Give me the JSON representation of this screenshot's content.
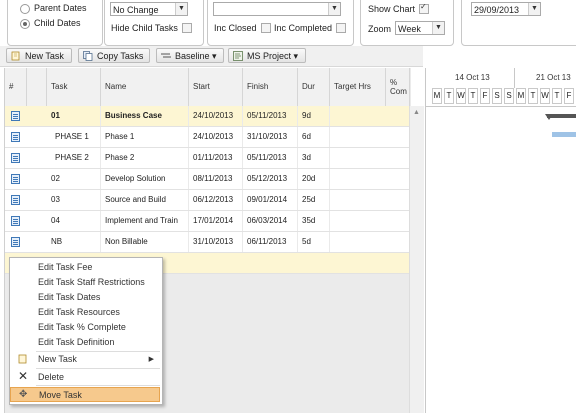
{
  "filters": {
    "date_options": [
      {
        "label": "Parent Dates",
        "checked": false
      },
      {
        "label": "Child Dates",
        "checked": true
      }
    ],
    "change_select": "No Change",
    "hide_child_tasks_label": "Hide Child Tasks",
    "blank_select": "",
    "inc_closed_label": "Inc Closed",
    "inc_completed_label": "Inc Completed",
    "show_chart_label": "Show Chart",
    "zoom_label": "Zoom",
    "zoom_value": "Week",
    "date_value": "29/09/2013"
  },
  "toolbar": {
    "new_task": "New Task",
    "copy_tasks": "Copy Tasks",
    "baseline": "Baseline",
    "ms_project": "MS Project"
  },
  "grid": {
    "columns": [
      "#",
      "",
      "Task",
      "Name",
      "Start",
      "Finish",
      "Dur",
      "Target Hrs",
      "% Com"
    ],
    "rows": [
      {
        "task": "01",
        "name": "Business Case",
        "start": "24/10/2013",
        "finish": "05/11/2013",
        "dur": "9d",
        "bold": true
      },
      {
        "task": "PHASE 1",
        "name": "Phase 1",
        "start": "24/10/2013",
        "finish": "31/10/2013",
        "dur": "6d",
        "bold": false
      },
      {
        "task": "PHASE 2",
        "name": "Phase 2",
        "start": "01/11/2013",
        "finish": "05/11/2013",
        "dur": "3d",
        "bold": false
      },
      {
        "task": "02",
        "name": "Develop Solution",
        "start": "08/11/2013",
        "finish": "05/12/2013",
        "dur": "20d",
        "bold": false
      },
      {
        "task": "03",
        "name": "Source and Build",
        "start": "06/12/2013",
        "finish": "09/01/2014",
        "dur": "25d",
        "bold": false
      },
      {
        "task": "04",
        "name": "Implement and Train",
        "start": "17/01/2014",
        "finish": "06/03/2014",
        "dur": "35d",
        "bold": false
      },
      {
        "task": "NB",
        "name": "Non Billable",
        "start": "31/10/2013",
        "finish": "06/11/2013",
        "dur": "5d",
        "bold": false
      }
    ]
  },
  "gantt": {
    "weeks": [
      "14 Oct 13",
      "21 Oct 13"
    ],
    "days": [
      "M",
      "T",
      "W",
      "T",
      "F",
      "S",
      "S",
      "M",
      "T",
      "W",
      "T",
      "F"
    ]
  },
  "context_menu": {
    "items": [
      {
        "label": "Edit Task Fee",
        "icon": ""
      },
      {
        "label": "Edit Task Staff Restrictions",
        "icon": ""
      },
      {
        "label": "Edit Task Dates",
        "icon": ""
      },
      {
        "label": "Edit Task Resources",
        "icon": ""
      },
      {
        "label": "Edit Task % Complete",
        "icon": ""
      },
      {
        "label": "Edit Task Definition",
        "icon": ""
      },
      {
        "label": "New Task",
        "icon": "new-task-icon",
        "submenu": true
      },
      {
        "label": "Delete",
        "icon": "delete-icon"
      },
      {
        "label": "Move Task",
        "icon": "move-icon",
        "selected": true
      }
    ]
  }
}
